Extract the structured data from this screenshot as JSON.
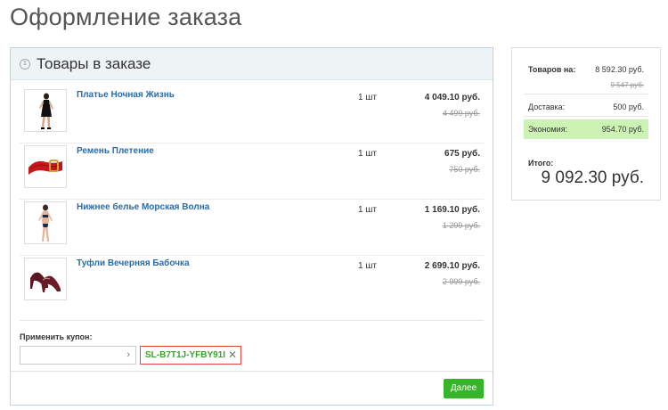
{
  "page": {
    "title": "Оформление заказа"
  },
  "order": {
    "step": "1",
    "header": "Товары в заказе",
    "items": [
      {
        "name": "Платье Ночная Жизнь",
        "qty": "1 шт",
        "price": "4 049.10 руб.",
        "old_price": "4 499 руб.",
        "image": "dress-image"
      },
      {
        "name": "Ремень Плетение",
        "qty": "1 шт",
        "price": "675 руб.",
        "old_price": "750 руб.",
        "image": "belt-image"
      },
      {
        "name": "Нижнее белье Морская Волна",
        "qty": "1 шт",
        "price": "1 169.10 руб.",
        "old_price": "1 299 руб.",
        "image": "lingerie-image"
      },
      {
        "name": "Туфли Вечерняя Бабочка",
        "qty": "1 шт",
        "price": "2 699.10 руб.",
        "old_price": "2 999 руб.",
        "image": "shoes-image"
      }
    ],
    "coupon": {
      "label": "Применить купон:",
      "placeholder": "",
      "arrow": "›",
      "code": "SL-B7T1J-YFBY91I",
      "remove": "✕"
    },
    "next_label": "Далее"
  },
  "summary": {
    "goods_label": "Товаров на:",
    "goods_value": "8 592.30 руб.",
    "goods_old": "9 547 руб.",
    "delivery_label": "Доставка:",
    "delivery_value": "500 руб.",
    "savings_label": "Экономия:",
    "savings_value": "954.70 руб.",
    "total_label": "Итого:",
    "total_value": "9 092.30 руб."
  },
  "colors": {
    "accent": "#37b52a",
    "link": "#2a6ca8",
    "savings_bg": "#ccf3b4",
    "coupon_border": "#e0473e"
  }
}
